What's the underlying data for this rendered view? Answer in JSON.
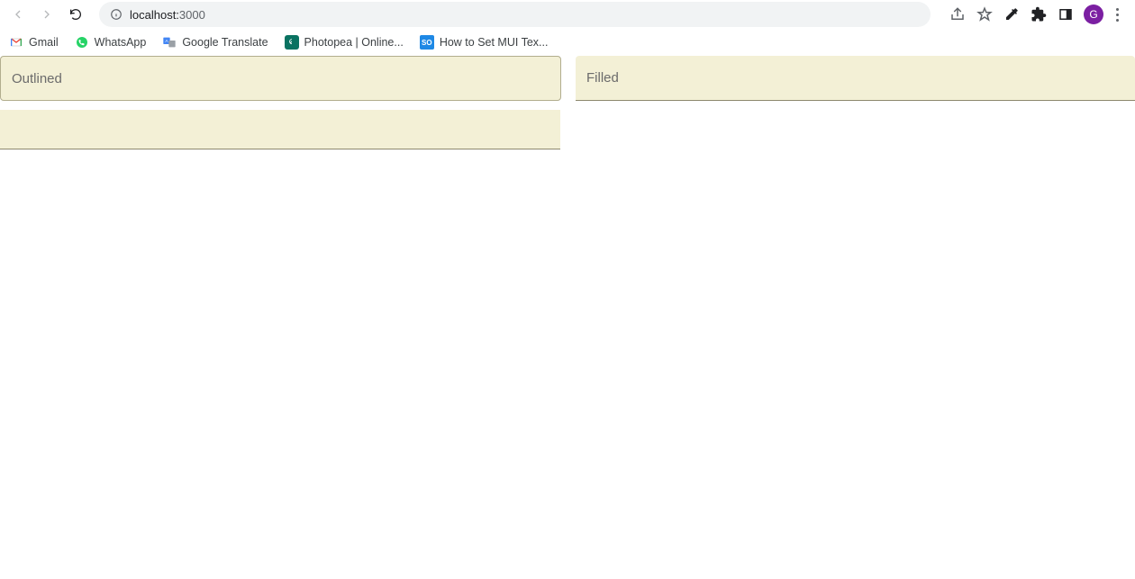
{
  "browser": {
    "url_host": "localhost:",
    "url_port": "3000",
    "avatar_initial": "G"
  },
  "bookmarks": [
    {
      "label": "Gmail"
    },
    {
      "label": "WhatsApp"
    },
    {
      "label": "Google Translate"
    },
    {
      "label": "Photopea | Online..."
    },
    {
      "label": "How to Set MUI Tex..."
    }
  ],
  "fields": {
    "outlined": {
      "label": "Outlined"
    },
    "filled": {
      "label": "Filled"
    },
    "standard": {
      "label": ""
    }
  }
}
